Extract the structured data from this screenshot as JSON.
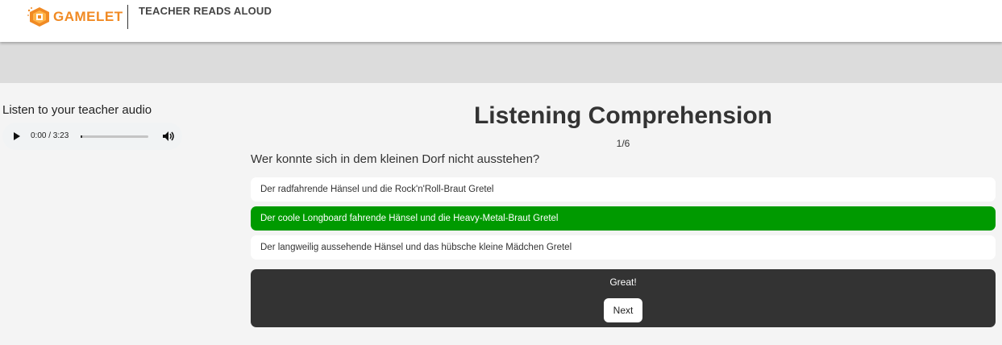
{
  "header": {
    "brand": "GAMELET",
    "app_title": "TEACHER READS ALOUD",
    "brand_color": "#f08a24"
  },
  "audio": {
    "label": "Listen to your teacher audio",
    "time": "0:00 / 3:23",
    "progress_fraction": 0.0
  },
  "quiz": {
    "title": "Listening Comprehension",
    "progress": "1/6",
    "question": "Wer konnte sich in dem kleinen Dorf nicht ausstehen?",
    "answers": [
      {
        "text": "Der radfahrende Hänsel und die Rock'n'Roll-Braut Gretel",
        "selected": false
      },
      {
        "text": "Der coole Longboard fahrende Hänsel und die Heavy-Metal-Braut Gretel",
        "selected": true
      },
      {
        "text": "Der langweilig aussehende Hänsel und das hübsche kleine Mädchen Gretel",
        "selected": false
      }
    ],
    "correct_color": "#009a00"
  },
  "feedback": {
    "message": "Great!",
    "next_label": "Next"
  }
}
